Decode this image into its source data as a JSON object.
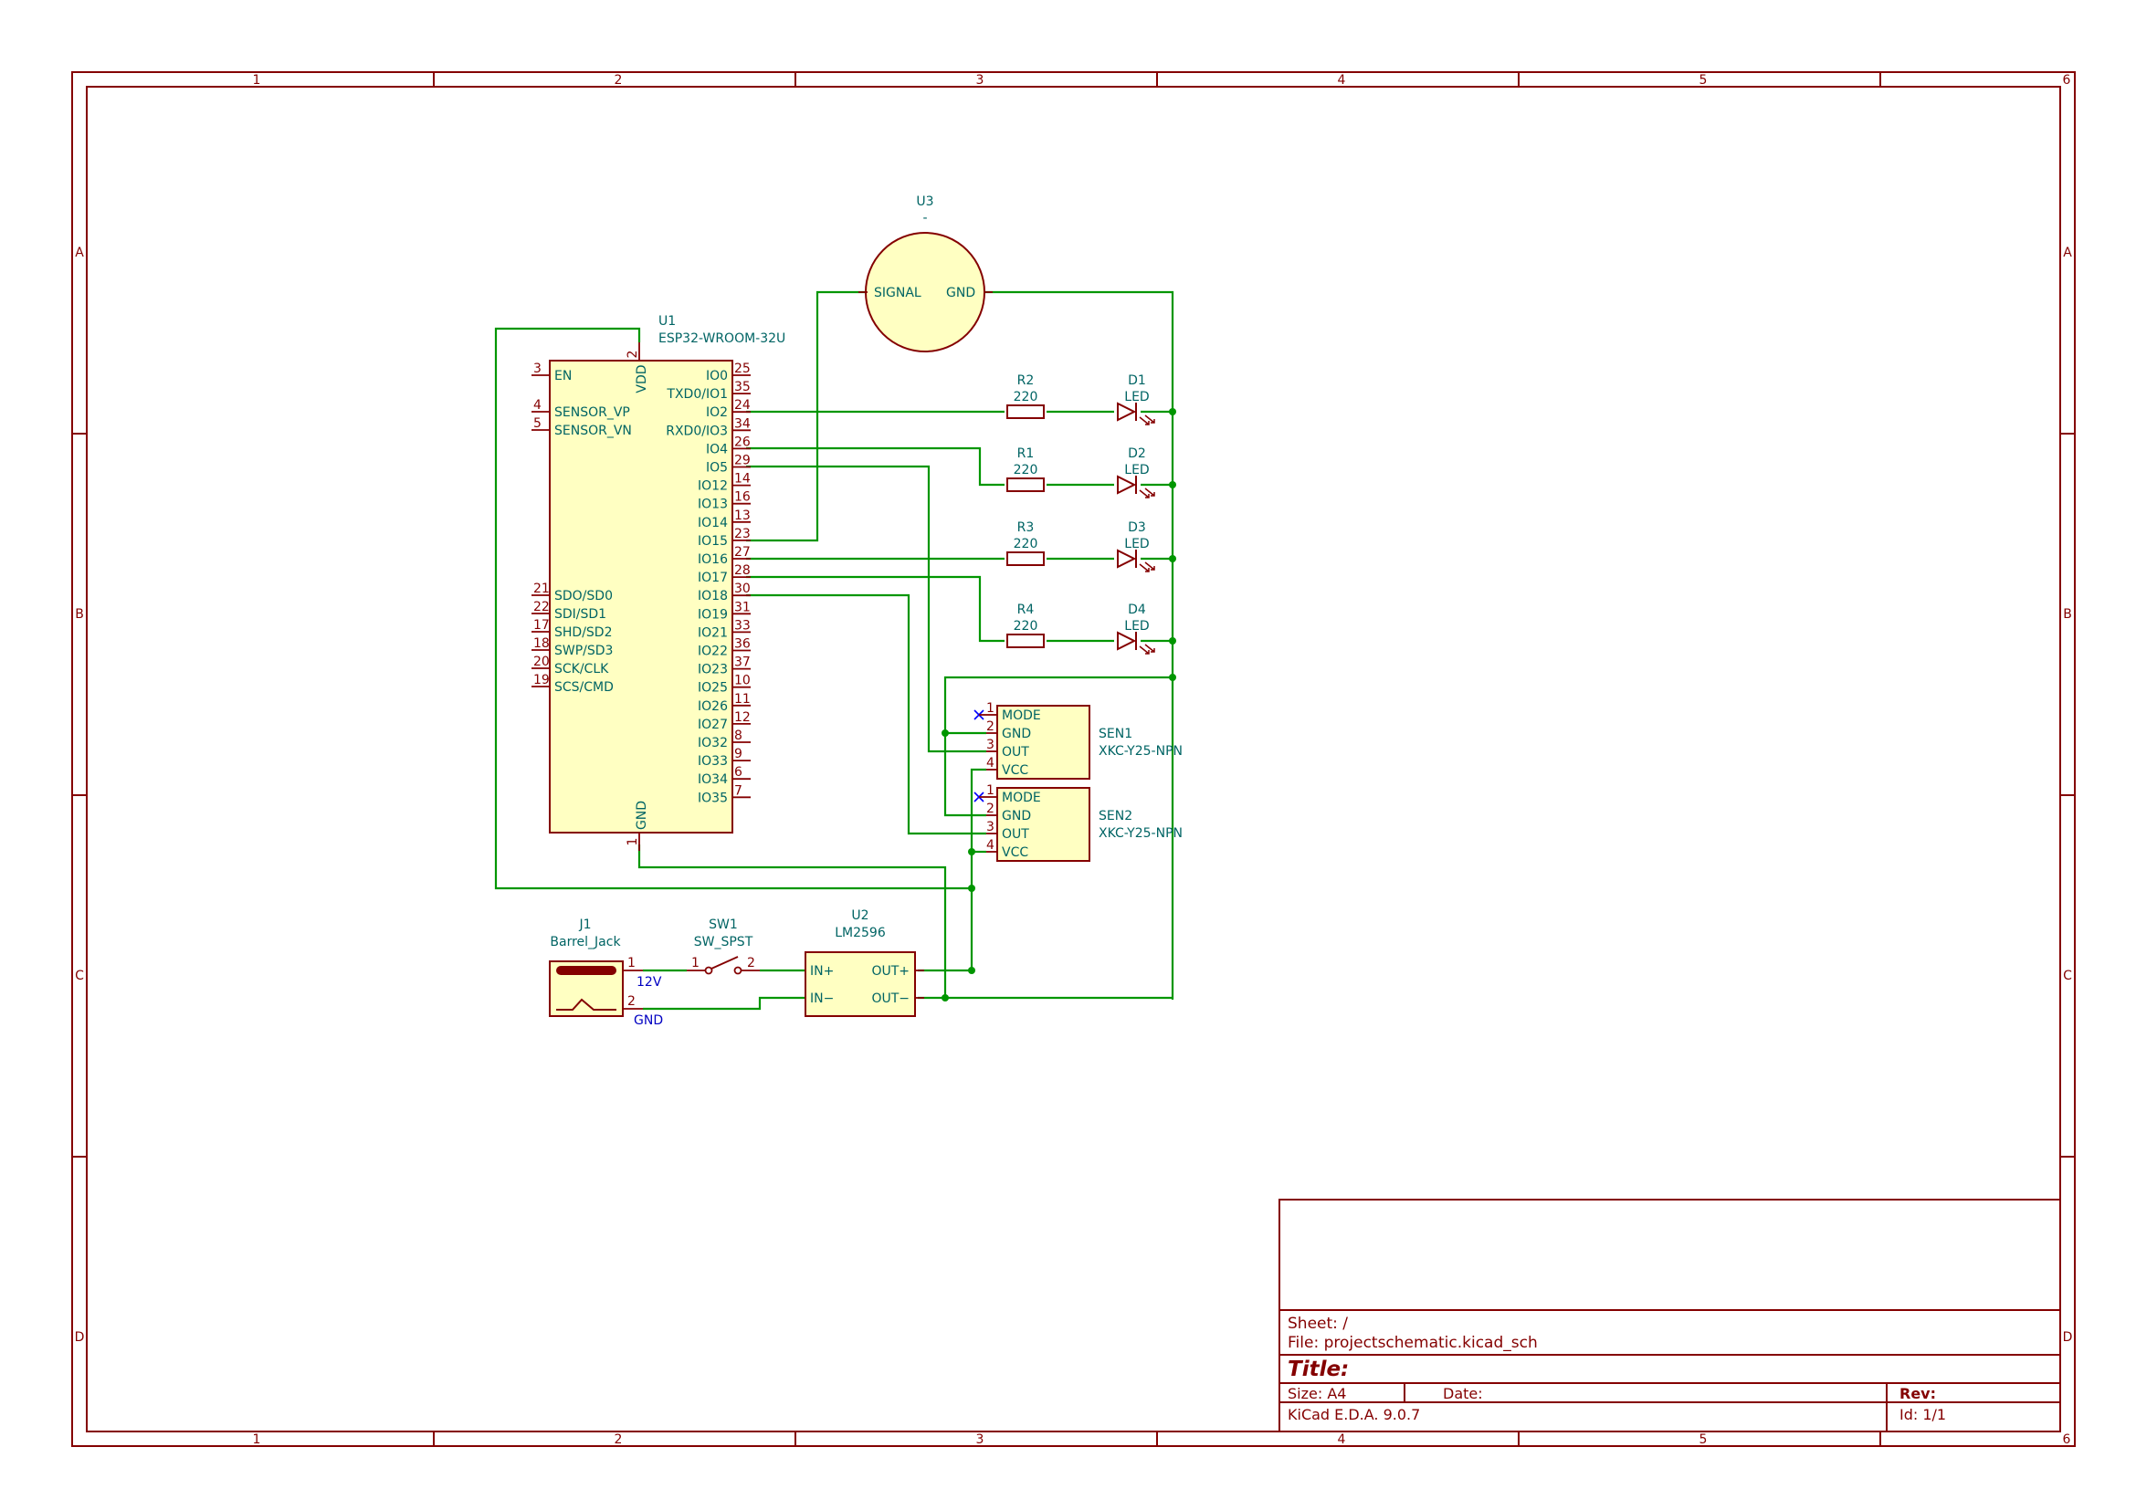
{
  "border": {
    "col_labels": [
      "1",
      "2",
      "3",
      "4",
      "5",
      "6"
    ],
    "row_labels": [
      "A",
      "B",
      "C",
      "D"
    ]
  },
  "title_block": {
    "sheet": "Sheet: /",
    "file": "File: projectschematic.kicad_sch",
    "title": "Title:",
    "size": "Size: A4",
    "date": "Date:",
    "rev": "Rev:",
    "tool": "KiCad E.D.A. 9.0.7",
    "id": "Id: 1/1"
  },
  "components": {
    "u1": {
      "ref": "U1",
      "value": "ESP32-WROOM-32U",
      "pin_vdd": "VDD",
      "pin_vdd_num": "2",
      "pin_gnd": "GND",
      "pin_gnd_num": "1",
      "left_pins": [
        {
          "num": "3",
          "name": "EN"
        },
        {
          "num": "4",
          "name": "SENSOR_VP"
        },
        {
          "num": "5",
          "name": "SENSOR_VN"
        },
        {
          "num": "21",
          "name": "SDO/SD0"
        },
        {
          "num": "22",
          "name": "SDI/SD1"
        },
        {
          "num": "17",
          "name": "SHD/SD2"
        },
        {
          "num": "18",
          "name": "SWP/SD3"
        },
        {
          "num": "20",
          "name": "SCK/CLK"
        },
        {
          "num": "19",
          "name": "SCS/CMD"
        }
      ],
      "right_pins": [
        {
          "num": "25",
          "name": "IO0"
        },
        {
          "num": "35",
          "name": "TXD0/IO1"
        },
        {
          "num": "24",
          "name": "IO2"
        },
        {
          "num": "34",
          "name": "RXD0/IO3"
        },
        {
          "num": "26",
          "name": "IO4"
        },
        {
          "num": "29",
          "name": "IO5"
        },
        {
          "num": "14",
          "name": "IO12"
        },
        {
          "num": "16",
          "name": "IO13"
        },
        {
          "num": "13",
          "name": "IO14"
        },
        {
          "num": "23",
          "name": "IO15"
        },
        {
          "num": "27",
          "name": "IO16"
        },
        {
          "num": "28",
          "name": "IO17"
        },
        {
          "num": "30",
          "name": "IO18"
        },
        {
          "num": "31",
          "name": "IO19"
        },
        {
          "num": "33",
          "name": "IO21"
        },
        {
          "num": "36",
          "name": "IO22"
        },
        {
          "num": "37",
          "name": "IO23"
        },
        {
          "num": "10",
          "name": "IO25"
        },
        {
          "num": "11",
          "name": "IO26"
        },
        {
          "num": "12",
          "name": "IO27"
        },
        {
          "num": "8",
          "name": "IO32"
        },
        {
          "num": "9",
          "name": "IO33"
        },
        {
          "num": "6",
          "name": "IO34"
        },
        {
          "num": "7",
          "name": "IO35"
        }
      ]
    },
    "u3": {
      "ref": "U3",
      "value": "-",
      "pin_signal": "SIGNAL",
      "pin_gnd": "GND"
    },
    "resistors": [
      {
        "ref": "R2",
        "value": "220"
      },
      {
        "ref": "R1",
        "value": "220"
      },
      {
        "ref": "R3",
        "value": "220"
      },
      {
        "ref": "R4",
        "value": "220"
      }
    ],
    "leds": [
      {
        "ref": "D1",
        "value": "LED"
      },
      {
        "ref": "D2",
        "value": "LED"
      },
      {
        "ref": "D3",
        "value": "LED"
      },
      {
        "ref": "D4",
        "value": "LED"
      }
    ],
    "sensors": [
      {
        "ref": "SEN1",
        "value": "XKC-Y25-NPN",
        "pins": [
          {
            "num": "1",
            "name": "MODE"
          },
          {
            "num": "2",
            "name": "GND"
          },
          {
            "num": "3",
            "name": "OUT"
          },
          {
            "num": "4",
            "name": "VCC"
          }
        ]
      },
      {
        "ref": "SEN2",
        "value": "XKC-Y25-NPN",
        "pins": [
          {
            "num": "1",
            "name": "MODE"
          },
          {
            "num": "2",
            "name": "GND"
          },
          {
            "num": "3",
            "name": "OUT"
          },
          {
            "num": "4",
            "name": "VCC"
          }
        ]
      }
    ],
    "j1": {
      "ref": "J1",
      "value": "Barrel_Jack",
      "pin1": "1",
      "pin2": "2",
      "net1": "12V",
      "net2": "GND"
    },
    "sw1": {
      "ref": "SW1",
      "value": "SW_SPST",
      "pin1": "1",
      "pin2": "2"
    },
    "u2": {
      "ref": "U2",
      "value": "LM2596",
      "in_p": "IN+",
      "in_n": "IN−",
      "out_p": "OUT+",
      "out_n": "OUT−"
    }
  }
}
